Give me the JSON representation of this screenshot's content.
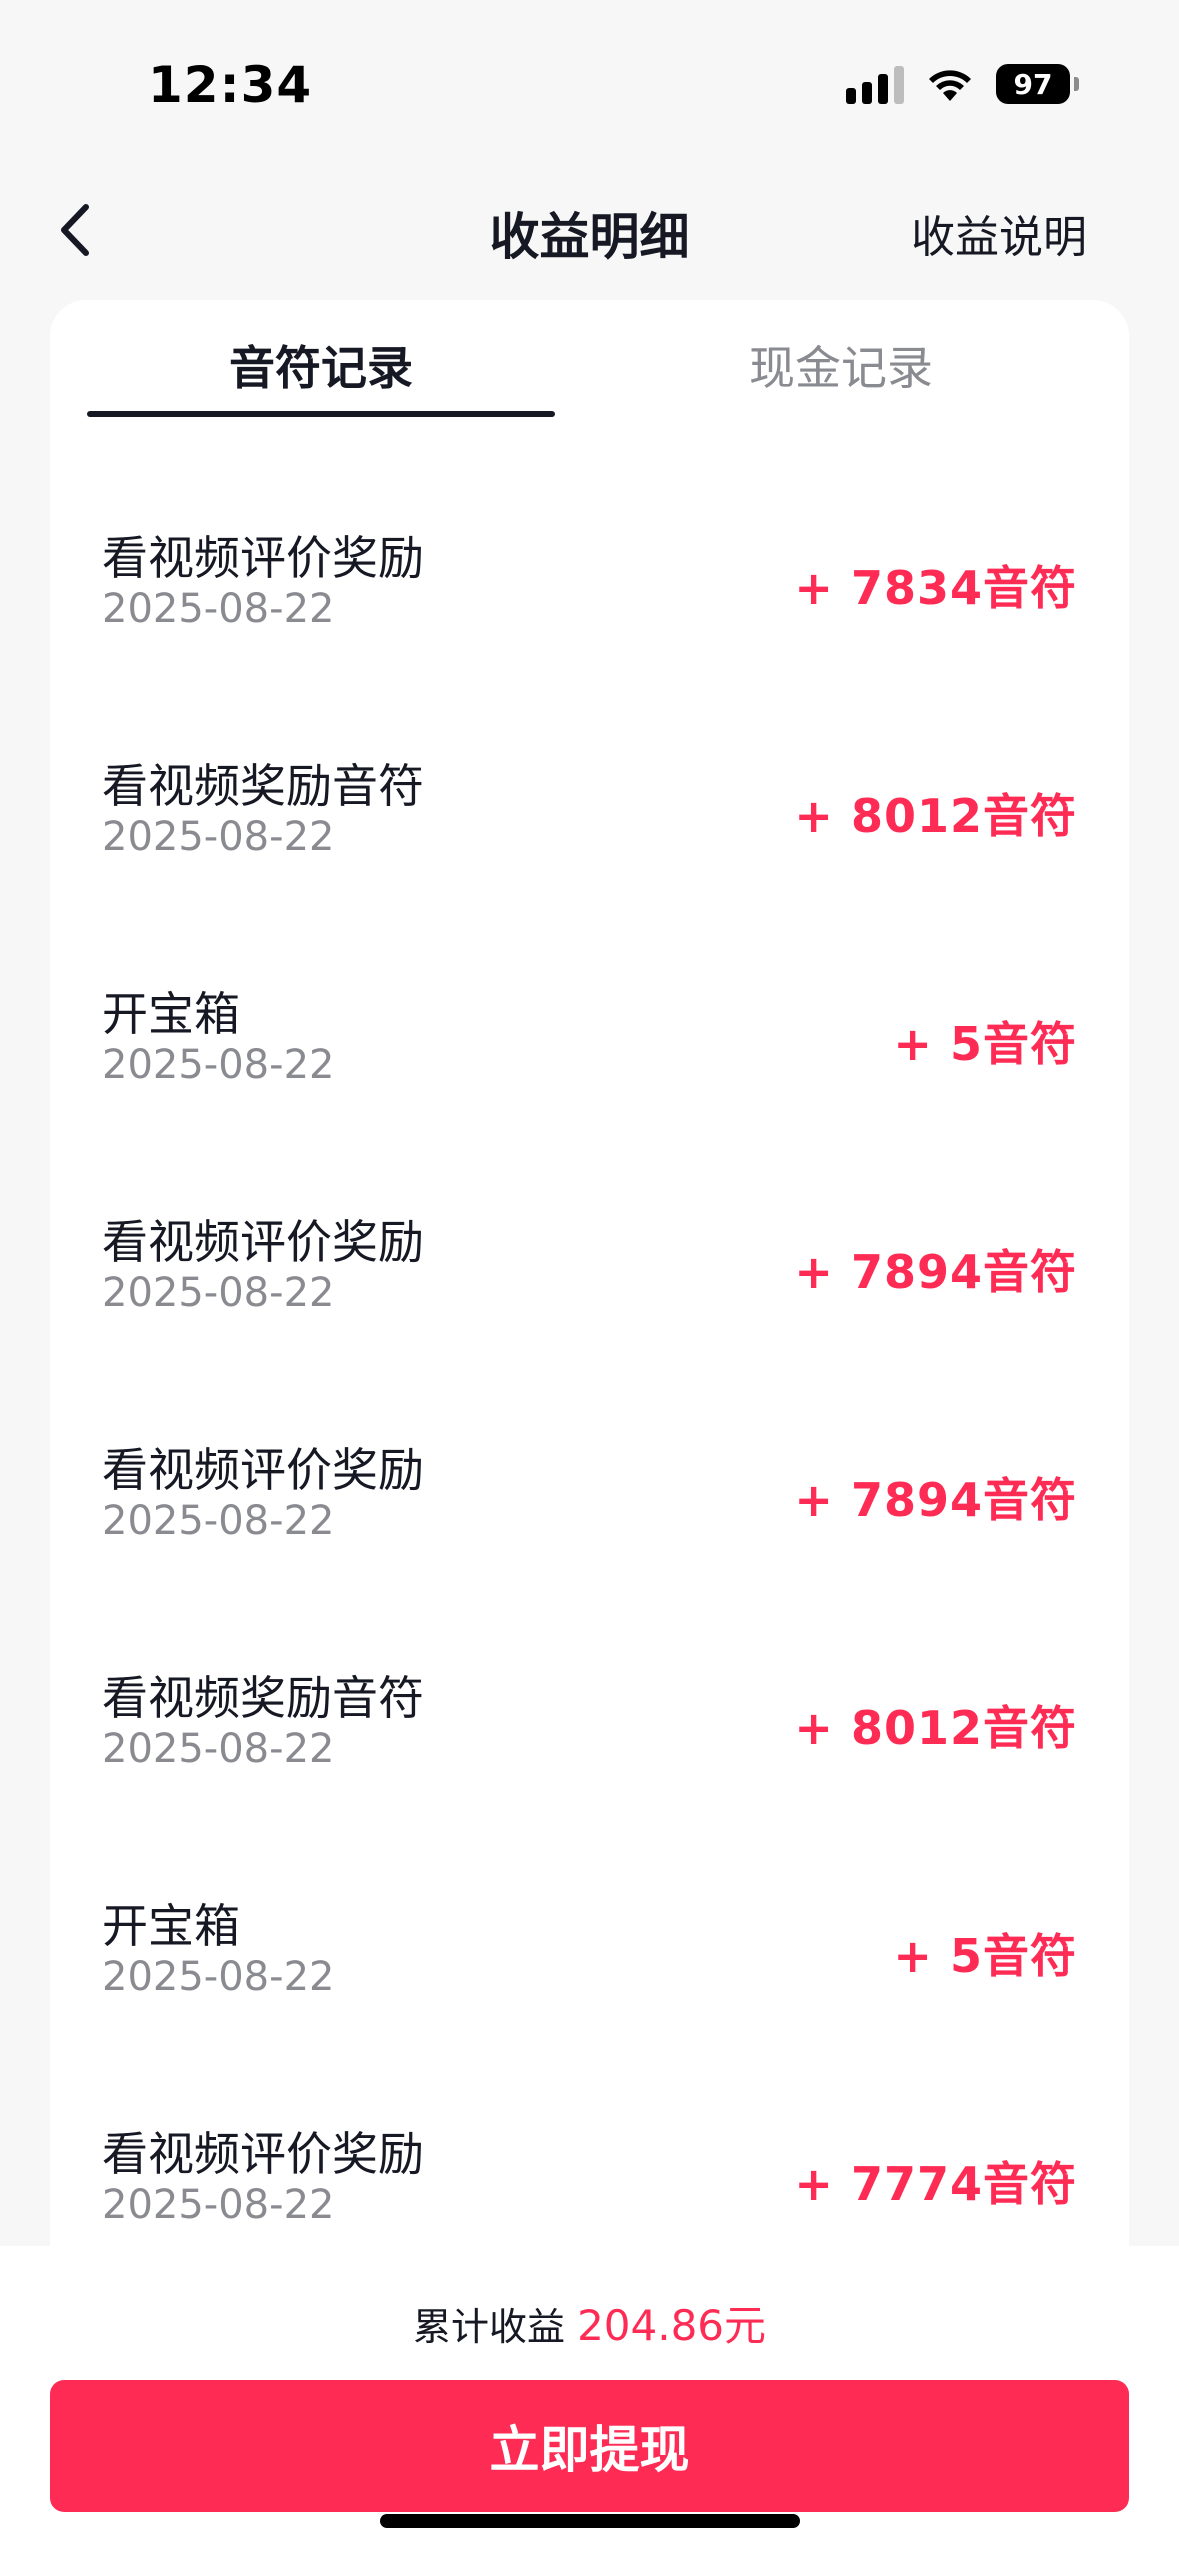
{
  "status_bar": {
    "time": "12:34",
    "battery": "97",
    "icons": [
      "signal-icon",
      "wifi-icon",
      "battery-icon"
    ]
  },
  "nav": {
    "title": "收益明细",
    "right_link": "收益说明",
    "back_icon": "chevron-left-icon"
  },
  "tabs": [
    {
      "label": "音符记录",
      "active": true
    },
    {
      "label": "现金记录",
      "active": false
    }
  ],
  "records": [
    {
      "title": "看视频评价奖励",
      "date": "2025-08-22",
      "amount": "+ 7834音符"
    },
    {
      "title": "看视频奖励音符",
      "date": "2025-08-22",
      "amount": "+ 8012音符"
    },
    {
      "title": "开宝箱",
      "date": "2025-08-22",
      "amount": "+ 5音符"
    },
    {
      "title": "看视频评价奖励",
      "date": "2025-08-22",
      "amount": "+ 7894音符"
    },
    {
      "title": "看视频评价奖励",
      "date": "2025-08-22",
      "amount": "+ 7894音符"
    },
    {
      "title": "看视频奖励音符",
      "date": "2025-08-22",
      "amount": "+ 8012音符"
    },
    {
      "title": "开宝箱",
      "date": "2025-08-22",
      "amount": "+ 5音符"
    },
    {
      "title": "看视频评价奖励",
      "date": "2025-08-22",
      "amount": "+ 7774音符"
    }
  ],
  "footer": {
    "total_label": "累计收益",
    "total_value": "204.86元",
    "withdraw_label": "立即提现"
  },
  "colors": {
    "accent": "#fe2c55",
    "text_primary": "#161823",
    "text_secondary": "#8a8b91",
    "background": "#f7f7f7"
  }
}
